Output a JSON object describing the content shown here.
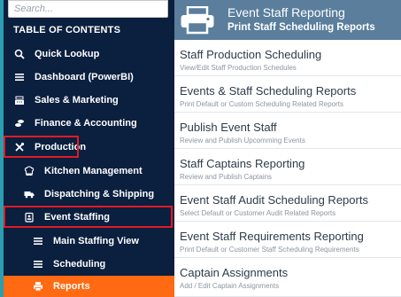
{
  "sidebar": {
    "search_placeholder": "Search...",
    "toc_heading": "TABLE OF CONTENTS",
    "items": [
      {
        "label": "Quick Lookup",
        "icon": "search-icon"
      },
      {
        "label": "Dashboard (PowerBI)",
        "icon": "menu-lines-icon"
      },
      {
        "label": "Sales & Marketing",
        "icon": "cash-register-icon"
      },
      {
        "label": "Finance & Accounting",
        "icon": "coins-icon"
      },
      {
        "label": "Production",
        "icon": "tools-icon"
      },
      {
        "label": "Kitchen Management",
        "icon": "chef-hat-icon"
      },
      {
        "label": "Dispatching & Shipping",
        "icon": "truck-icon"
      },
      {
        "label": "Event Staffing",
        "icon": "badge-icon"
      },
      {
        "label": "Main Staffing View",
        "icon": "menu-lines-icon"
      },
      {
        "label": "Scheduling",
        "icon": "menu-lines-icon"
      },
      {
        "label": "Reports",
        "icon": "printer-icon"
      }
    ]
  },
  "header": {
    "title": "Event Staff Reporting",
    "subtitle": "Print Staff Scheduling Reports",
    "icon": "printer-icon"
  },
  "reports": [
    {
      "title": "Staff Production Scheduling",
      "desc": "View/Edit Staff Production Schedules"
    },
    {
      "title": "Events & Staff Scheduling Reports",
      "desc": "Print Default or Custom Scheduling Related Reports"
    },
    {
      "title": "Publish Event Staff",
      "desc": "Review and Publish Upcomming Events"
    },
    {
      "title": "Staff Captains Reporting",
      "desc": "Review and Publish Captains"
    },
    {
      "title": "Event Staff Audit Scheduling Reports",
      "desc": "Select Default or Customer Audit Related Reports"
    },
    {
      "title": "Event Staff Requirements Reporting",
      "desc": "Print Default or Customer Staff Scheduling Requirements"
    },
    {
      "title": "Captain Assignments",
      "desc": "Add / Edit Captain Assignments"
    }
  ],
  "colors": {
    "sidebar_bg": "#0b1f3f",
    "header_bg": "#5a7e9c",
    "active_item": "#ff6a13",
    "highlight_outline": "#e01b24",
    "left_strip": "#2a9fb0"
  }
}
